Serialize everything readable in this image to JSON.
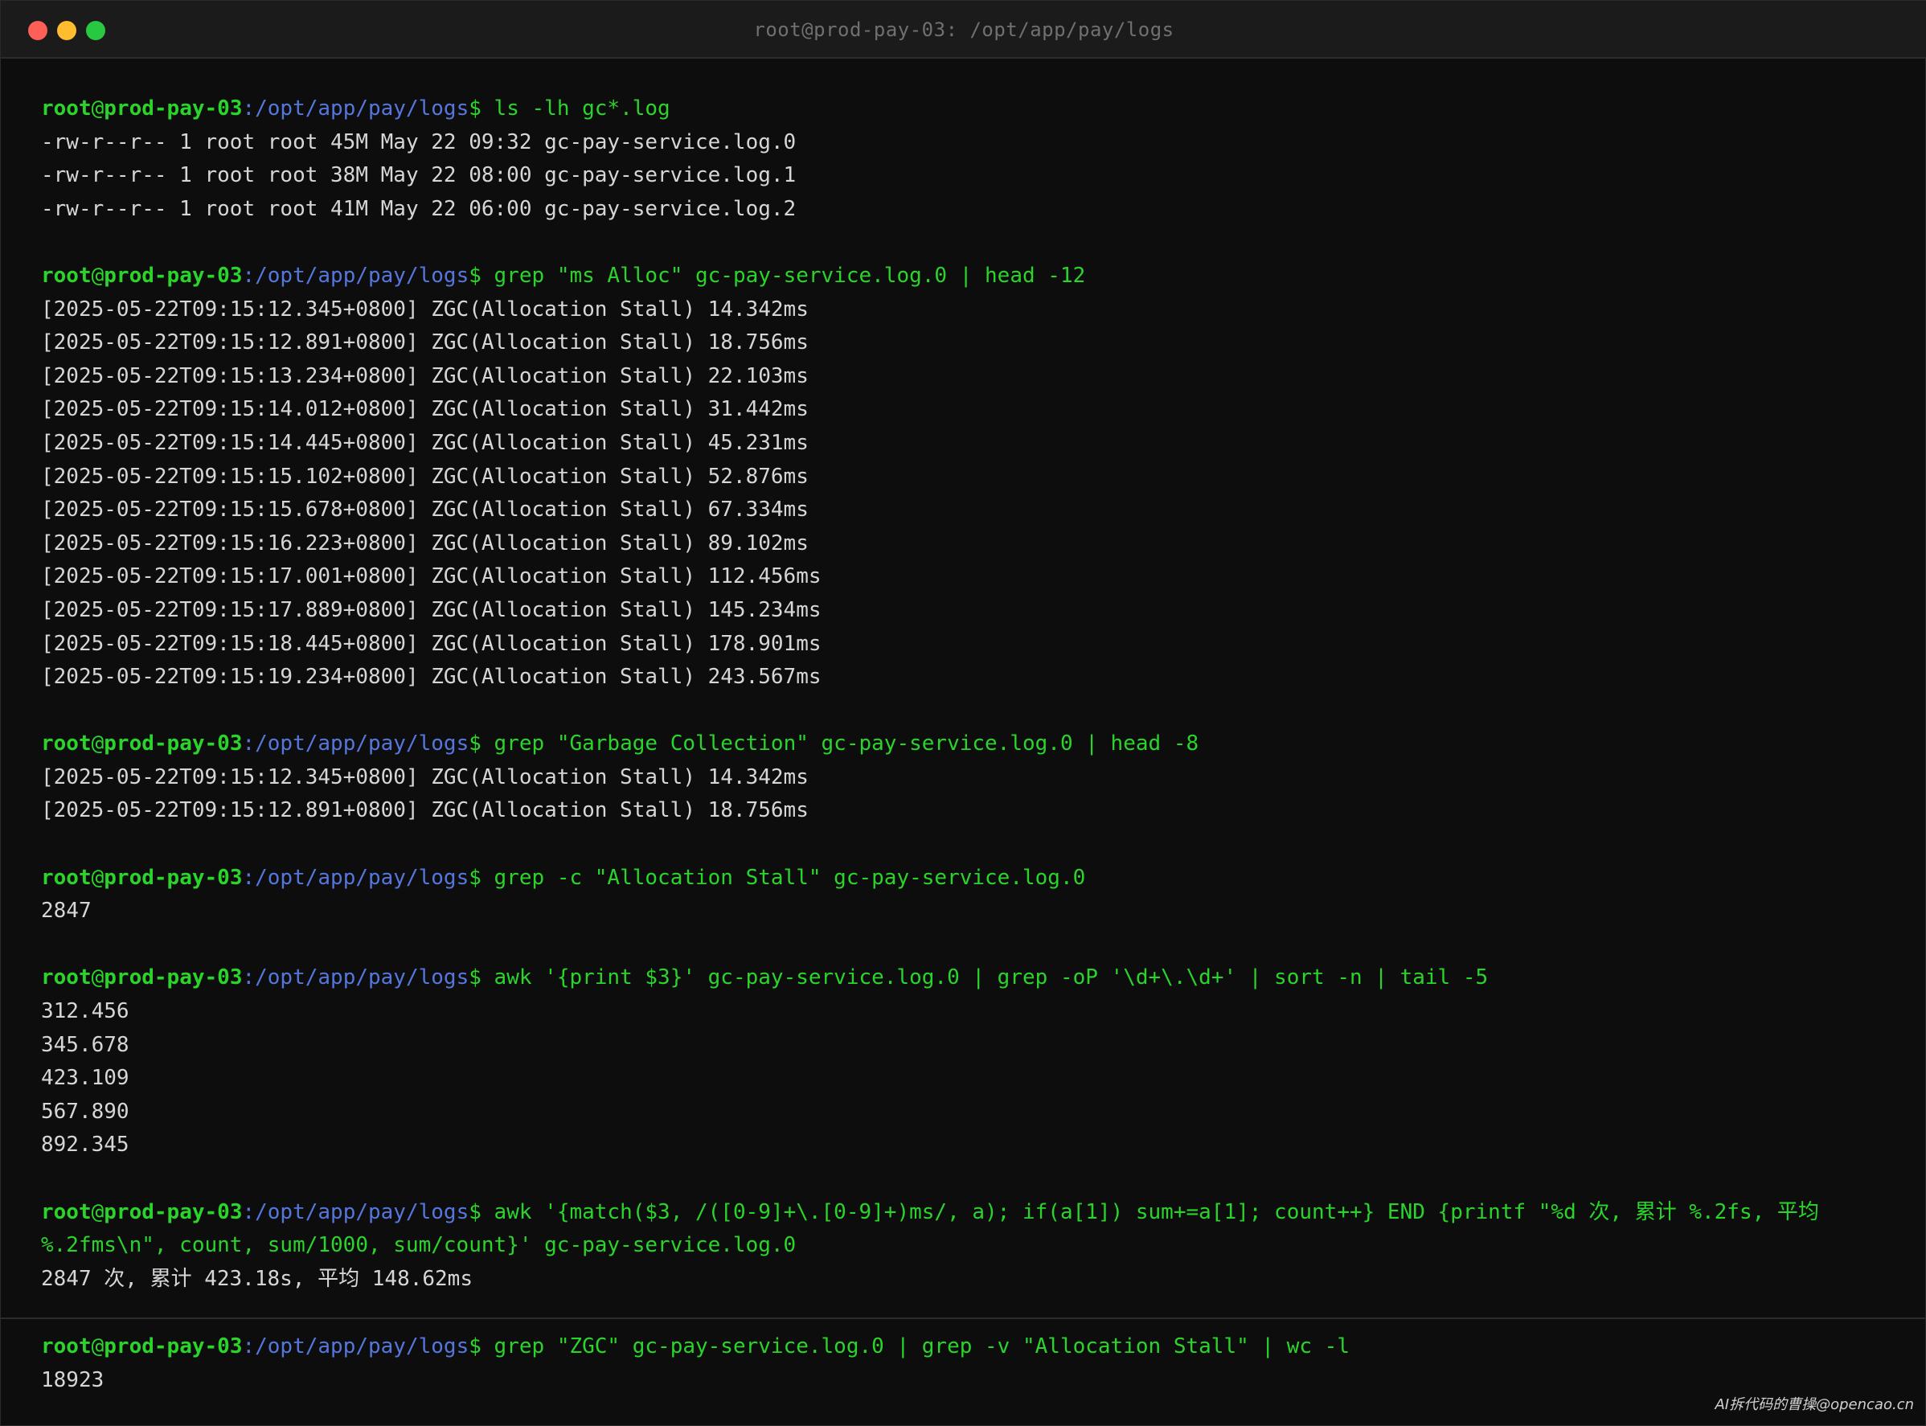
{
  "window": {
    "title": "root@prod-pay-03: /opt/app/pay/logs"
  },
  "prompt": {
    "user": "root",
    "at": "@",
    "host": "prod-pay-03",
    "path": ":/opt/app/pay/logs",
    "dollar": "$"
  },
  "blocks": [
    {
      "command": "ls -lh gc*.log",
      "output": [
        "-rw-r--r-- 1 root root 45M May 22 09:32 gc-pay-service.log.0",
        "-rw-r--r-- 1 root root 38M May 22 08:00 gc-pay-service.log.1",
        "-rw-r--r-- 1 root root 41M May 22 06:00 gc-pay-service.log.2"
      ]
    },
    {
      "command": "grep \"ms Alloc\" gc-pay-service.log.0 | head -12",
      "output": [
        "[2025-05-22T09:15:12.345+0800] ZGC(Allocation Stall) 14.342ms",
        "[2025-05-22T09:15:12.891+0800] ZGC(Allocation Stall) 18.756ms",
        "[2025-05-22T09:15:13.234+0800] ZGC(Allocation Stall) 22.103ms",
        "[2025-05-22T09:15:14.012+0800] ZGC(Allocation Stall) 31.442ms",
        "[2025-05-22T09:15:14.445+0800] ZGC(Allocation Stall) 45.231ms",
        "[2025-05-22T09:15:15.102+0800] ZGC(Allocation Stall) 52.876ms",
        "[2025-05-22T09:15:15.678+0800] ZGC(Allocation Stall) 67.334ms",
        "[2025-05-22T09:15:16.223+0800] ZGC(Allocation Stall) 89.102ms",
        "[2025-05-22T09:15:17.001+0800] ZGC(Allocation Stall) 112.456ms",
        "[2025-05-22T09:15:17.889+0800] ZGC(Allocation Stall) 145.234ms",
        "[2025-05-22T09:15:18.445+0800] ZGC(Allocation Stall) 178.901ms",
        "[2025-05-22T09:15:19.234+0800] ZGC(Allocation Stall) 243.567ms"
      ]
    },
    {
      "command": "grep \"Garbage Collection\" gc-pay-service.log.0 | head -8",
      "output": [
        "[2025-05-22T09:15:12.345+0800] ZGC(Allocation Stall) 14.342ms",
        "[2025-05-22T09:15:12.891+0800] ZGC(Allocation Stall) 18.756ms"
      ]
    },
    {
      "command": "grep -c \"Allocation Stall\" gc-pay-service.log.0",
      "output": [
        "2847"
      ]
    },
    {
      "command": "awk '{print $3}' gc-pay-service.log.0 | grep -oP '\\d+\\.\\d+' | sort -n | tail -5",
      "output": [
        "312.456",
        "345.678",
        "423.109",
        "567.890",
        "892.345"
      ]
    },
    {
      "command": "awk '{match($3, /([0-9]+\\.[0-9]+)ms/, a); if(a[1]) sum+=a[1]; count++} END {printf \"%d 次, 累计 %.2fs, 平均",
      "command_cont": "%.2fms\\n\", count, sum/1000, sum/count}' gc-pay-service.log.0",
      "output": [
        "2847 次, 累计 423.18s, 平均 148.62ms"
      ]
    }
  ],
  "last_block": {
    "command": "grep \"ZGC\" gc-pay-service.log.0 | grep -v \"Allocation Stall\" | wc -l",
    "output": "18923"
  },
  "watermark": "AI拆代码的曹操@opencao.cn",
  "colors": {
    "prompt_green": "#2bd42b",
    "path_blue": "#5577dd",
    "output_text": "#d6d6d6",
    "background": "#0d0d0d"
  }
}
